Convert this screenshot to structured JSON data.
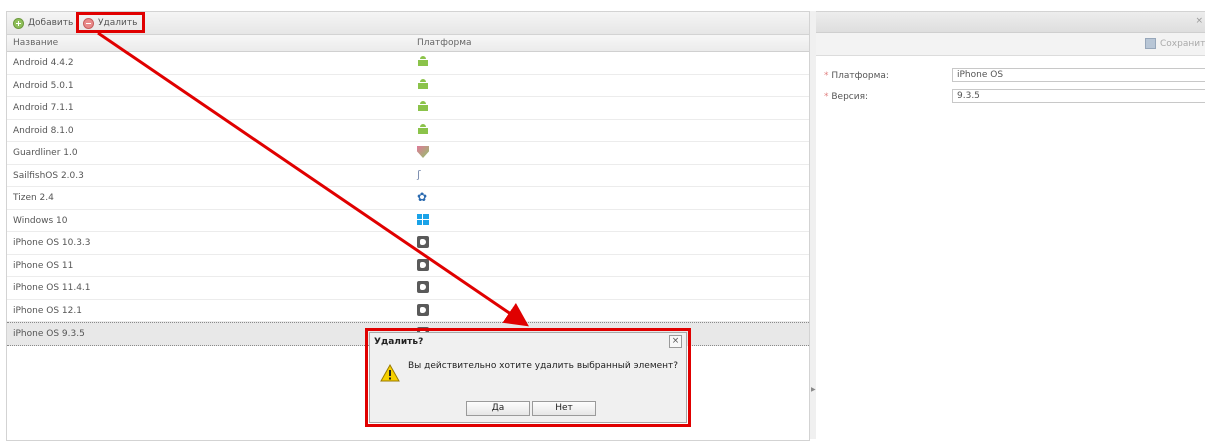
{
  "toolbar": {
    "add_label": "Добавить",
    "delete_label": "Удалить"
  },
  "grid": {
    "columns": [
      "Название",
      "Платформа"
    ],
    "rows": [
      {
        "name": "Android 4.4.2",
        "platform_icon": "android-icon"
      },
      {
        "name": "Android 5.0.1",
        "platform_icon": "android-icon"
      },
      {
        "name": "Android 7.1.1",
        "platform_icon": "android-icon"
      },
      {
        "name": "Android 8.1.0",
        "platform_icon": "android-icon"
      },
      {
        "name": "Guardliner 1.0",
        "platform_icon": "guardliner-shield-icon"
      },
      {
        "name": "SailfishOS 2.0.3",
        "platform_icon": "sailfish-icon"
      },
      {
        "name": "Tizen 2.4",
        "platform_icon": "tizen-icon"
      },
      {
        "name": "Windows 10",
        "platform_icon": "windows-icon"
      },
      {
        "name": "iPhone OS 10.3.3",
        "platform_icon": "ios-icon"
      },
      {
        "name": "iPhone OS 11",
        "platform_icon": "ios-icon"
      },
      {
        "name": "iPhone OS 11.4.1",
        "platform_icon": "ios-icon"
      },
      {
        "name": "iPhone OS 12.1",
        "platform_icon": "ios-icon"
      },
      {
        "name": "iPhone OS 9.3.5",
        "platform_icon": "ios-icon",
        "selected": true
      }
    ]
  },
  "editor": {
    "save_label": "Сохранить",
    "close_glyph": "×",
    "fields": [
      {
        "label": "Платформа:",
        "value": "iPhone OS"
      },
      {
        "label": "Версия:",
        "value": "9.3.5"
      }
    ]
  },
  "dialog": {
    "title": "Удалить?",
    "close_glyph": "×",
    "message": "Вы действительно хотите удалить выбранный элемент?",
    "yes_label": "Да",
    "no_label": "Нет"
  },
  "annotation_color": "#e00000"
}
